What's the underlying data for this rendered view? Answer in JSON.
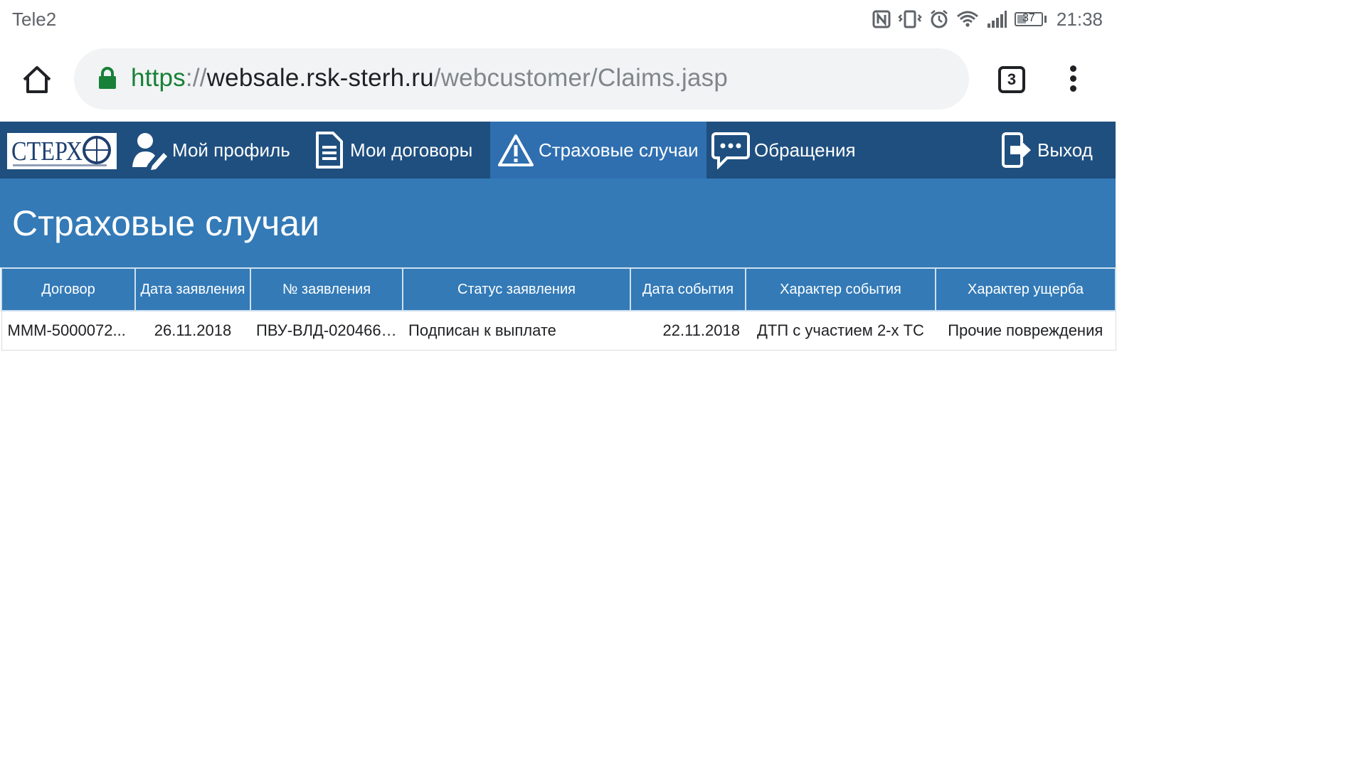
{
  "status_bar": {
    "carrier": "Tele2",
    "battery_level": "37",
    "battery_percent": 37,
    "time": "21:38",
    "icons": [
      "nfc-icon",
      "vibrate-icon",
      "alarm-icon",
      "wifi-icon",
      "signal-icon",
      "battery-icon"
    ]
  },
  "browser": {
    "url_scheme": "https",
    "url_separator": "://",
    "url_host": "websale.rsk-sterh.ru",
    "url_path": "/webcustomer/Claims.jasp",
    "tab_count": "3",
    "colors": {
      "scheme": "#188038",
      "path": "#80868b"
    }
  },
  "nav": {
    "logo_text": "СТЕРХ",
    "items": [
      {
        "label": "Мой профиль",
        "icon": "user-edit-icon"
      },
      {
        "label": "Мои договоры",
        "icon": "document-icon"
      },
      {
        "label": "Страховые случаи",
        "icon": "warning-icon",
        "active": true
      },
      {
        "label": "Обращения",
        "icon": "chat-icon"
      }
    ],
    "logout": {
      "label": "Выход",
      "icon": "logout-icon"
    },
    "colors": {
      "bar": "#1f4f7f",
      "active": "#2f6fb0"
    }
  },
  "header": {
    "title": "Страховые случаи",
    "color": "#337ab7"
  },
  "table": {
    "columns": [
      "Договор",
      "Дата заявления",
      "№ заявления",
      "Статус заявления",
      "Дата события",
      "Характер события",
      "Характер ущерба"
    ],
    "rows": [
      [
        "МММ-5000072...",
        "26.11.2018",
        "ПВУ-ВЛД-020466/...",
        "Подписан к выплате",
        "22.11.2018",
        "ДТП с участием 2-х ТС",
        "Прочие повреждения"
      ]
    ]
  }
}
